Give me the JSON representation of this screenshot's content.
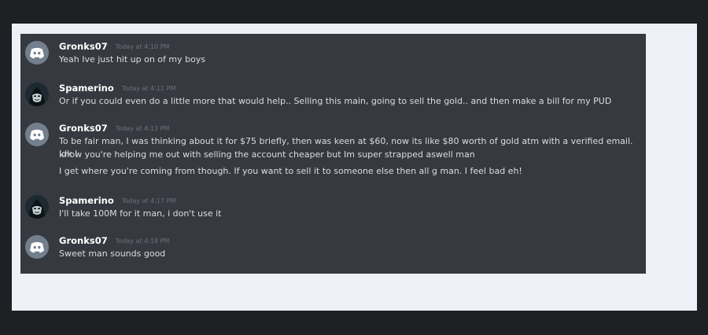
{
  "messages": [
    {
      "author": "Gronks07",
      "avatar": "discord-default-avatar",
      "timestamp": "Today at 4:10 PM",
      "lines": [
        "Yeah Ive just hit up on of my boys"
      ]
    },
    {
      "author": "Spamerino",
      "avatar": "hooded-figure-avatar",
      "timestamp": "Today at 4:11 PM",
      "lines": [
        "Or if you could even do a little more that would help.. Selling this main, going to sell the gold.. and then make a bill for my PUD"
      ]
    },
    {
      "author": "Gronks07",
      "avatar": "discord-default-avatar",
      "timestamp": "Today at 4:13 PM",
      "lines": [
        "To be fair man, I was thinking about it for $75 briefly, then was keen at $60, now its like $80 worth of gold atm with a verified email. Idk I",
        "know you're helping me out with selling the account cheaper but Im super strapped aswell man",
        "I get where you're coming from though. If you want to sell it to someone else then all g man. I feel bad eh!"
      ]
    },
    {
      "author": "Spamerino",
      "avatar": "hooded-figure-avatar",
      "timestamp": "Today at 4:17 PM",
      "lines": [
        "I'll take 100M for it man, i don't use it"
      ]
    },
    {
      "author": "Gronks07",
      "avatar": "discord-default-avatar",
      "timestamp": "Today at 4:18 PM",
      "lines": [
        "Sweet man sounds good"
      ]
    }
  ],
  "colors": {
    "chat_bg": "#36393f",
    "frame_bg": "#eef2f8",
    "page_bg": "#1f2023",
    "username": "#ffffff",
    "message_text": "#dcddde",
    "timestamp": "#6d727b",
    "discord_avatar_bg": "#747f8d"
  }
}
